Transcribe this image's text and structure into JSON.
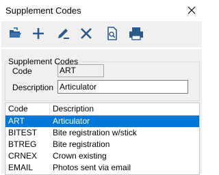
{
  "window": {
    "title": "Supplement Codes"
  },
  "toolbar": {
    "buttons": [
      {
        "name": "open-icon"
      },
      {
        "name": "add-icon"
      },
      {
        "name": "edit-icon"
      },
      {
        "name": "delete-icon"
      },
      {
        "name": "preview-icon"
      },
      {
        "name": "print-icon"
      }
    ]
  },
  "form": {
    "group_title": "Supplement Codes",
    "code_label": "Code",
    "code_value": "ART",
    "description_label": "Description",
    "description_value": "Articulator"
  },
  "grid": {
    "columns": [
      "Code",
      "Description"
    ],
    "rows": [
      {
        "code": "ART",
        "description": "Articulator",
        "selected": true
      },
      {
        "code": "BITEST",
        "description": "Bite registration w/stick",
        "selected": false
      },
      {
        "code": "BTREG",
        "description": "Bite registration",
        "selected": false
      },
      {
        "code": "CRNEX",
        "description": "Crown existing",
        "selected": false
      },
      {
        "code": "EMAIL",
        "description": "Photos sent via email",
        "selected": false
      }
    ]
  },
  "colors": {
    "selection": "#0078d7",
    "toolbar_icon": "#2a5a8c"
  }
}
